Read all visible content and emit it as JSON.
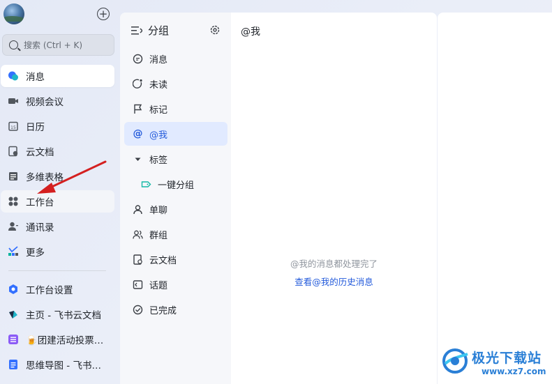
{
  "sidebar": {
    "search_placeholder": "搜索 (Ctrl + K)",
    "items": [
      {
        "label": "消息",
        "icon": "message-bubble-icon"
      },
      {
        "label": "视频会议",
        "icon": "video-camera-icon"
      },
      {
        "label": "日历",
        "icon": "calendar-icon"
      },
      {
        "label": "云文档",
        "icon": "cloud-doc-icon"
      },
      {
        "label": "多维表格",
        "icon": "base-table-icon"
      },
      {
        "label": "工作台",
        "icon": "workplace-grid-icon"
      },
      {
        "label": "通讯录",
        "icon": "contacts-icon"
      },
      {
        "label": "更多",
        "icon": "more-apps-icon"
      }
    ],
    "pinned": [
      {
        "label": "工作台设置",
        "icon": "settings-gear-icon"
      },
      {
        "label": "主页 - 飞书云文档",
        "icon": "feishu-docs-icon"
      },
      {
        "label": "🍺团建活动投票…",
        "icon": "bitable-icon"
      },
      {
        "label": "思维导图 - 飞书…",
        "icon": "document-icon"
      }
    ]
  },
  "groups": {
    "title": "分组",
    "items": [
      {
        "label": "消息"
      },
      {
        "label": "未读"
      },
      {
        "label": "标记"
      },
      {
        "label": "@我"
      },
      {
        "label": "标签"
      },
      {
        "label": "一键分组"
      },
      {
        "label": "单聊"
      },
      {
        "label": "群组"
      },
      {
        "label": "云文档"
      },
      {
        "label": "话题"
      },
      {
        "label": "已完成"
      }
    ]
  },
  "content": {
    "title": "@我",
    "empty_message": "@我的消息都处理完了",
    "history_link": "查看@我的历史消息"
  },
  "watermark": {
    "name": "极光下载站",
    "url": "www.xz7.com"
  },
  "colors": {
    "accent": "#245bdb",
    "active_group_bg": "#e1eaff",
    "annotation_arrow": "#d42020"
  }
}
